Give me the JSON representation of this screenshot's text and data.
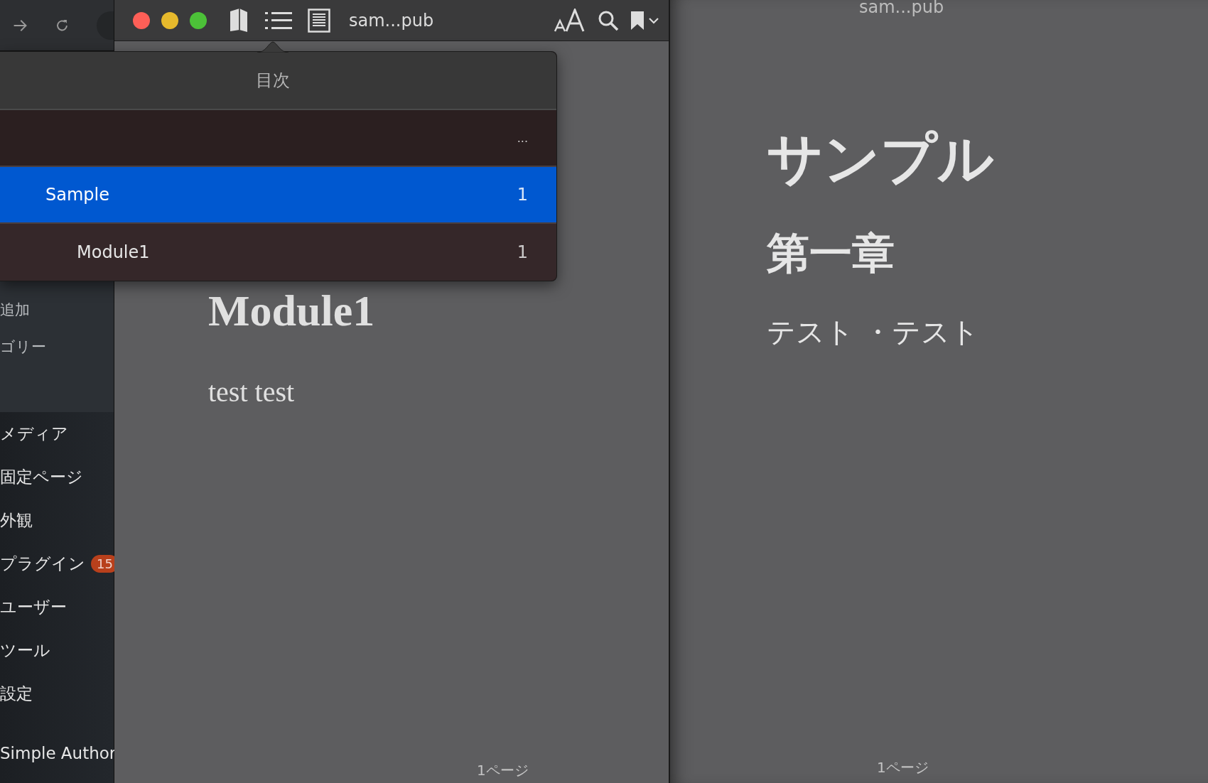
{
  "sidebar": {
    "items": [
      {
        "label": "追加",
        "submenu": true
      },
      {
        "label": "ゴリー",
        "submenu": true
      },
      {
        "label": "メディア",
        "submenu": false
      },
      {
        "label": "固定ページ",
        "submenu": false
      },
      {
        "label": "外観",
        "submenu": false
      },
      {
        "label": "プラグイン",
        "submenu": false,
        "badge": "15"
      },
      {
        "label": "ユーザー",
        "submenu": false
      },
      {
        "label": "ツール",
        "submenu": false
      },
      {
        "label": "設定",
        "submenu": false
      },
      {
        "label": "Simple Author",
        "submenu": false
      }
    ]
  },
  "reader": {
    "title": "sam...pub",
    "heading": "Module1",
    "paragraph": "test test",
    "page_label": "1ページ"
  },
  "toc": {
    "title": "目次",
    "items": [
      {
        "page": "...",
        "selected": false,
        "children": [
          {
            "label": "Sample",
            "page": "1",
            "selected": true,
            "children": [
              {
                "label": "Module1",
                "page": "1",
                "selected": false
              }
            ]
          }
        ]
      }
    ]
  },
  "preview": {
    "title": "sam...pub",
    "heading": "サンプル",
    "subheading": "第一章",
    "body": "テスト ・テスト",
    "page_label": "1ページ"
  }
}
